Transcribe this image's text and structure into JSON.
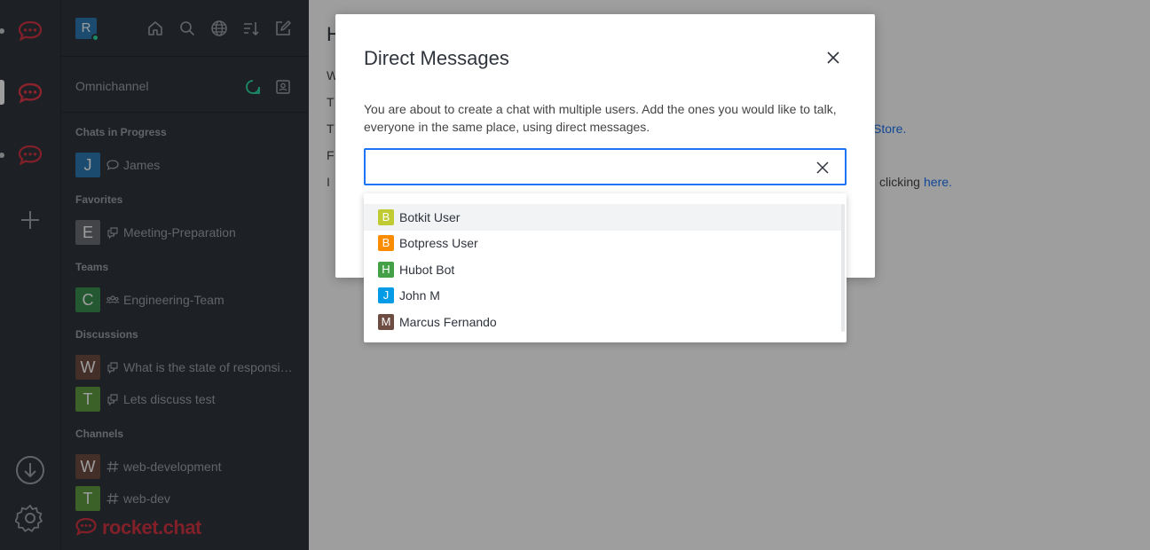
{
  "colors": {
    "accent": "#1d74f5",
    "brand": "#d13443",
    "online": "#2de0a5",
    "sidebar_bg": "#2f343d"
  },
  "rail": {
    "servers": [
      "rocket-chat-server-1",
      "rocket-chat-server-2",
      "rocket-chat-server-3"
    ],
    "add_icon": "plus-icon",
    "download_icon": "download-icon",
    "settings_icon": "gear-icon"
  },
  "sidebar": {
    "user_avatar": "R",
    "header_icons": [
      "home-icon",
      "search-icon",
      "directory-globe-icon",
      "sort-icon",
      "create-new-icon"
    ],
    "omnichannel": {
      "label": "Omnichannel",
      "icons": [
        "omnichannel-status-icon",
        "contact-center-icon"
      ]
    },
    "sections": [
      {
        "title": "Chats in Progress",
        "items": [
          {
            "avatar": "J",
            "color": "#2c7bb3",
            "icon": "livechat-icon",
            "label": "James"
          }
        ]
      },
      {
        "title": "Favorites",
        "items": [
          {
            "avatar": "E",
            "color": "#6b6e73",
            "icon": "discussion-icon",
            "label": "Meeting-Preparation"
          }
        ]
      },
      {
        "title": "Teams",
        "items": [
          {
            "avatar": "C",
            "color": "#3a8f50",
            "icon": "team-icon",
            "label": "Engineering-Team"
          }
        ]
      },
      {
        "title": "Discussions",
        "items": [
          {
            "avatar": "W",
            "color": "#6d4c41",
            "icon": "discussion-icon",
            "label": "What is the state of responsive design"
          },
          {
            "avatar": "T",
            "color": "#5f9c41",
            "icon": "discussion-icon",
            "label": "Lets discuss test"
          }
        ]
      },
      {
        "title": "Channels",
        "items": [
          {
            "avatar": "W",
            "color": "#6d4c41",
            "icon": "hashtag-icon",
            "label": "web-development"
          },
          {
            "avatar": "T",
            "color": "#5f9c41",
            "icon": "hashtag-icon",
            "label": "web-dev"
          }
        ]
      }
    ],
    "brand": "rocket.chat"
  },
  "main": {
    "title_partial": "H",
    "lines": [
      "W",
      "T",
      "T",
      "F",
      "I"
    ],
    "fragment_store": "Store.",
    "fragment_clicking": "clicking",
    "link_here": "here."
  },
  "modal": {
    "title": "Direct Messages",
    "close_icon": "close-icon",
    "description": "You are about to create a chat with multiple users. Add the ones you would like to talk, everyone in the same place, using direct messages.",
    "input_value": "",
    "input_placeholder": "",
    "clear_icon": "clear-input-icon"
  },
  "dropdown": {
    "options": [
      {
        "initial": "B",
        "color": "#c0ca33",
        "name": "Botkit User"
      },
      {
        "initial": "B",
        "color": "#fb8c00",
        "name": "Botpress User"
      },
      {
        "initial": "H",
        "color": "#43a047",
        "name": "Hubot Bot"
      },
      {
        "initial": "J",
        "color": "#039be5",
        "name": "John M"
      },
      {
        "initial": "M",
        "color": "#6d4c41",
        "name": "Marcus Fernando"
      }
    ],
    "highlighted_index": 0
  }
}
